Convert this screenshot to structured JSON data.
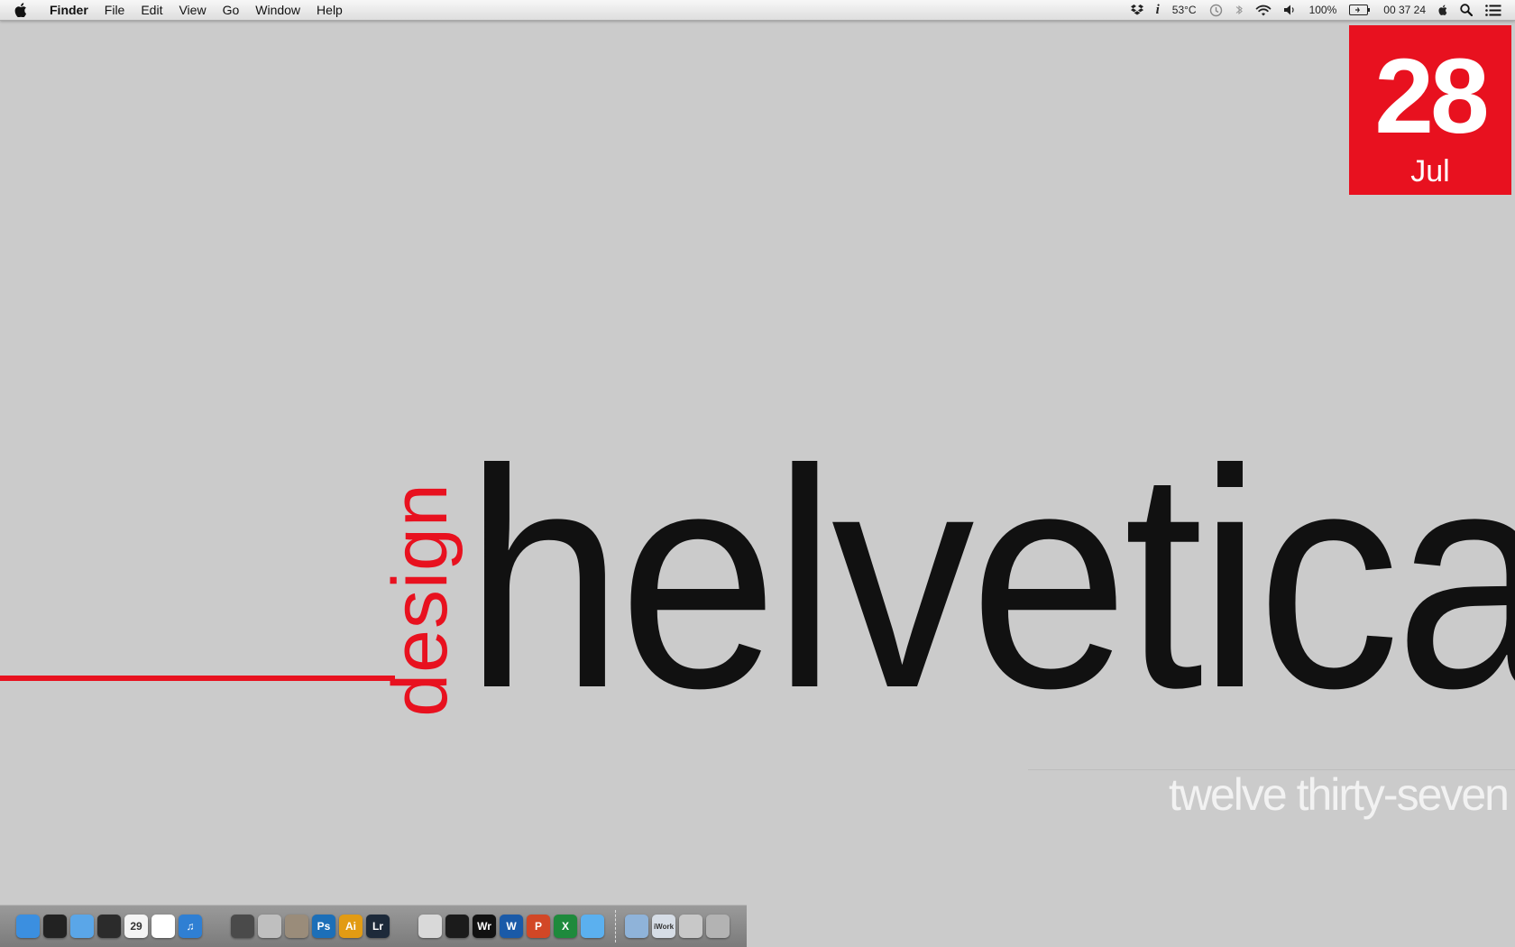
{
  "menubar": {
    "app_name": "Finder",
    "items": [
      "File",
      "Edit",
      "View",
      "Go",
      "Window",
      "Help"
    ],
    "status": {
      "temperature": "53°C",
      "battery": "100%",
      "clock": "00 37 24"
    }
  },
  "date_widget": {
    "day": "28",
    "month": "Jul"
  },
  "wallpaper": {
    "word_vertical": "design",
    "word_main": "helvetica",
    "time_words": "twelve thirty-seven",
    "accent_color": "#e8111f"
  },
  "dock": {
    "apps": [
      {
        "name": "finder-icon",
        "label": "",
        "color": "#3b8fe0"
      },
      {
        "name": "terminal-icon",
        "label": "",
        "color": "#222222"
      },
      {
        "name": "mail-icon",
        "label": "",
        "color": "#5aa6e8"
      },
      {
        "name": "safari-icon",
        "label": "",
        "color": "#2b2b2b"
      },
      {
        "name": "calendar-icon",
        "label": "29",
        "color": "#f4f4f4"
      },
      {
        "name": "textedit-icon",
        "label": "",
        "color": "#ffffff"
      },
      {
        "name": "itunes-icon",
        "label": "♫",
        "color": "#2f7fd3"
      },
      {
        "name": "final-cut-icon",
        "label": "",
        "color": "#4a4a4a"
      },
      {
        "name": "aperture-icon",
        "label": "",
        "color": "#bfbfbf"
      },
      {
        "name": "preview-icon",
        "label": "",
        "color": "#9a8c7a"
      },
      {
        "name": "photoshop-icon",
        "label": "Ps",
        "color": "#1c6fb8"
      },
      {
        "name": "illustrator-icon",
        "label": "Ai",
        "color": "#e29b13"
      },
      {
        "name": "lightroom-icon",
        "label": "Lr",
        "color": "#1d2a3a"
      },
      {
        "name": "pages-icon",
        "label": "",
        "color": "#d9d9d9"
      },
      {
        "name": "camera-icon",
        "label": "",
        "color": "#1b1b1b"
      },
      {
        "name": "writer-icon",
        "label": "Wr",
        "color": "#111111"
      },
      {
        "name": "word-icon",
        "label": "W",
        "color": "#1a5aa8"
      },
      {
        "name": "powerpoint-icon",
        "label": "P",
        "color": "#d24726"
      },
      {
        "name": "excel-icon",
        "label": "X",
        "color": "#1e8a3c"
      },
      {
        "name": "messages-icon",
        "label": "",
        "color": "#5bb0ef"
      }
    ],
    "folders": [
      {
        "name": "applications-folder-icon",
        "label": "",
        "color": "#8fb3d9"
      },
      {
        "name": "iwork-folder-icon",
        "label": "iWork",
        "color": "#d6dde6"
      },
      {
        "name": "downloads-stack-icon",
        "label": "",
        "color": "#c8c8c8"
      },
      {
        "name": "trash-icon",
        "label": "",
        "color": "#b3b3b3"
      }
    ]
  }
}
